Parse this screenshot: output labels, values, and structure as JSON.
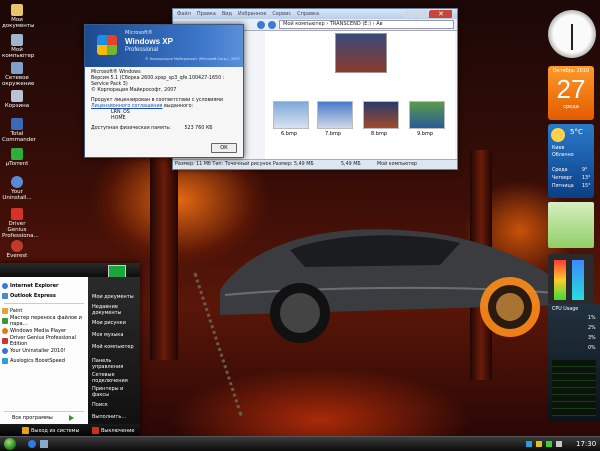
{
  "desktop_icons": [
    {
      "label": "Мои документы",
      "color": "#e9c56a"
    },
    {
      "label": "Мой компьютер",
      "color": "#9fb6cf"
    },
    {
      "label": "Сетевое окружение",
      "color": "#7fa1c9"
    },
    {
      "label": "Корзина",
      "color": "#b8c4d0"
    },
    {
      "label": "Total Commander",
      "color": "#3a6ab8"
    },
    {
      "label": "µTorrent",
      "color": "#2fae3a"
    },
    {
      "label": "Your Uninstall...",
      "color": "#5a8ad6"
    },
    {
      "label": "Driver Genius Professiona...",
      "color": "#d8302a"
    },
    {
      "label": "Everest",
      "color": "#c23a2a"
    }
  ],
  "explorer": {
    "menu": [
      "Файл",
      "Правка",
      "Вид",
      "Избранное",
      "Сервис",
      "Справка"
    ],
    "address": "Мой компьютер › TRANSCEND (E:) › Ав",
    "thumbs": [
      "6.bmp",
      "7.bmp",
      "8.bmp",
      "9.bmp"
    ],
    "status_left": "Размер: 11 Мб Тип: Точечный рисунок Размер: 5,49 МБ",
    "status_size": "5,49 МБ",
    "status_right": "Мой компьютер"
  },
  "about": {
    "brand": "Microsoft®",
    "logo": "Windows XP",
    "sub": "Professional",
    "copyright_head": "© Корпорация Майкрософт (Microsoft Corp.), 2007",
    "lines": [
      "Microsoft® Windows",
      "Версия 5.1 (Сборка 2600.xpsp_sp3_qfe.100427-1650 : Service Pack 3)",
      "© Корпорация Майкрософт, 2007"
    ],
    "license_intro": "Продукт лицензирован в соответствии с условиями",
    "license_link": "Лицензионного соглашения",
    "license_tail": "выданного:",
    "user": "LRN_OS",
    "org": "HOME",
    "memory_label": "Доступная физическая память:",
    "memory_value": "523 760 КБ",
    "ok_label": "ОК"
  },
  "gadgets": {
    "calendar_month": "Октябрь 2010",
    "calendar_day": "27",
    "calendar_weekday": "среда",
    "weather_temp": "5°C",
    "weather_city": "Киев",
    "weather_cond": "Облачно",
    "weather_days": [
      "Среда",
      "Четверг",
      "Пятница"
    ],
    "weather_highs": [
      "9°",
      "13°",
      "15°"
    ],
    "cpu_title": "CPU Usage",
    "cpu_rows": [
      "1%",
      "2%",
      "3%",
      "0%"
    ]
  },
  "start_menu": {
    "pinned": [
      {
        "label": "Internet Explorer",
        "color": "#2f7be0"
      },
      {
        "label": "Outlook Express",
        "color": "#4a8ad0"
      }
    ],
    "recent": [
      {
        "label": "Paint",
        "color": "#e6a23a"
      },
      {
        "label": "Мастер переноса файлов и пара...",
        "color": "#3a9a3a"
      },
      {
        "label": "Windows Media Player",
        "color": "#e07a10"
      },
      {
        "label": "Driver Genius Professional Edition",
        "color": "#d03030"
      },
      {
        "label": "Your Uninstaller 2010!",
        "color": "#3f6fd0"
      },
      {
        "label": "Auslogics BoostSpeed",
        "color": "#2aa0d8"
      }
    ],
    "all_programs": "Все программы",
    "right_items": [
      "Мои документы",
      "Недавние документы",
      "Мои рисунки",
      "Моя музыка",
      "Мой компьютер",
      "Панель управления",
      "Сетевые подключения",
      "Принтеры и факсы",
      "Поиск",
      "Выполнить..."
    ],
    "logoff": "Выход из системы",
    "shutdown": "Выключение"
  },
  "taskbar": {
    "clock": "17:30"
  }
}
